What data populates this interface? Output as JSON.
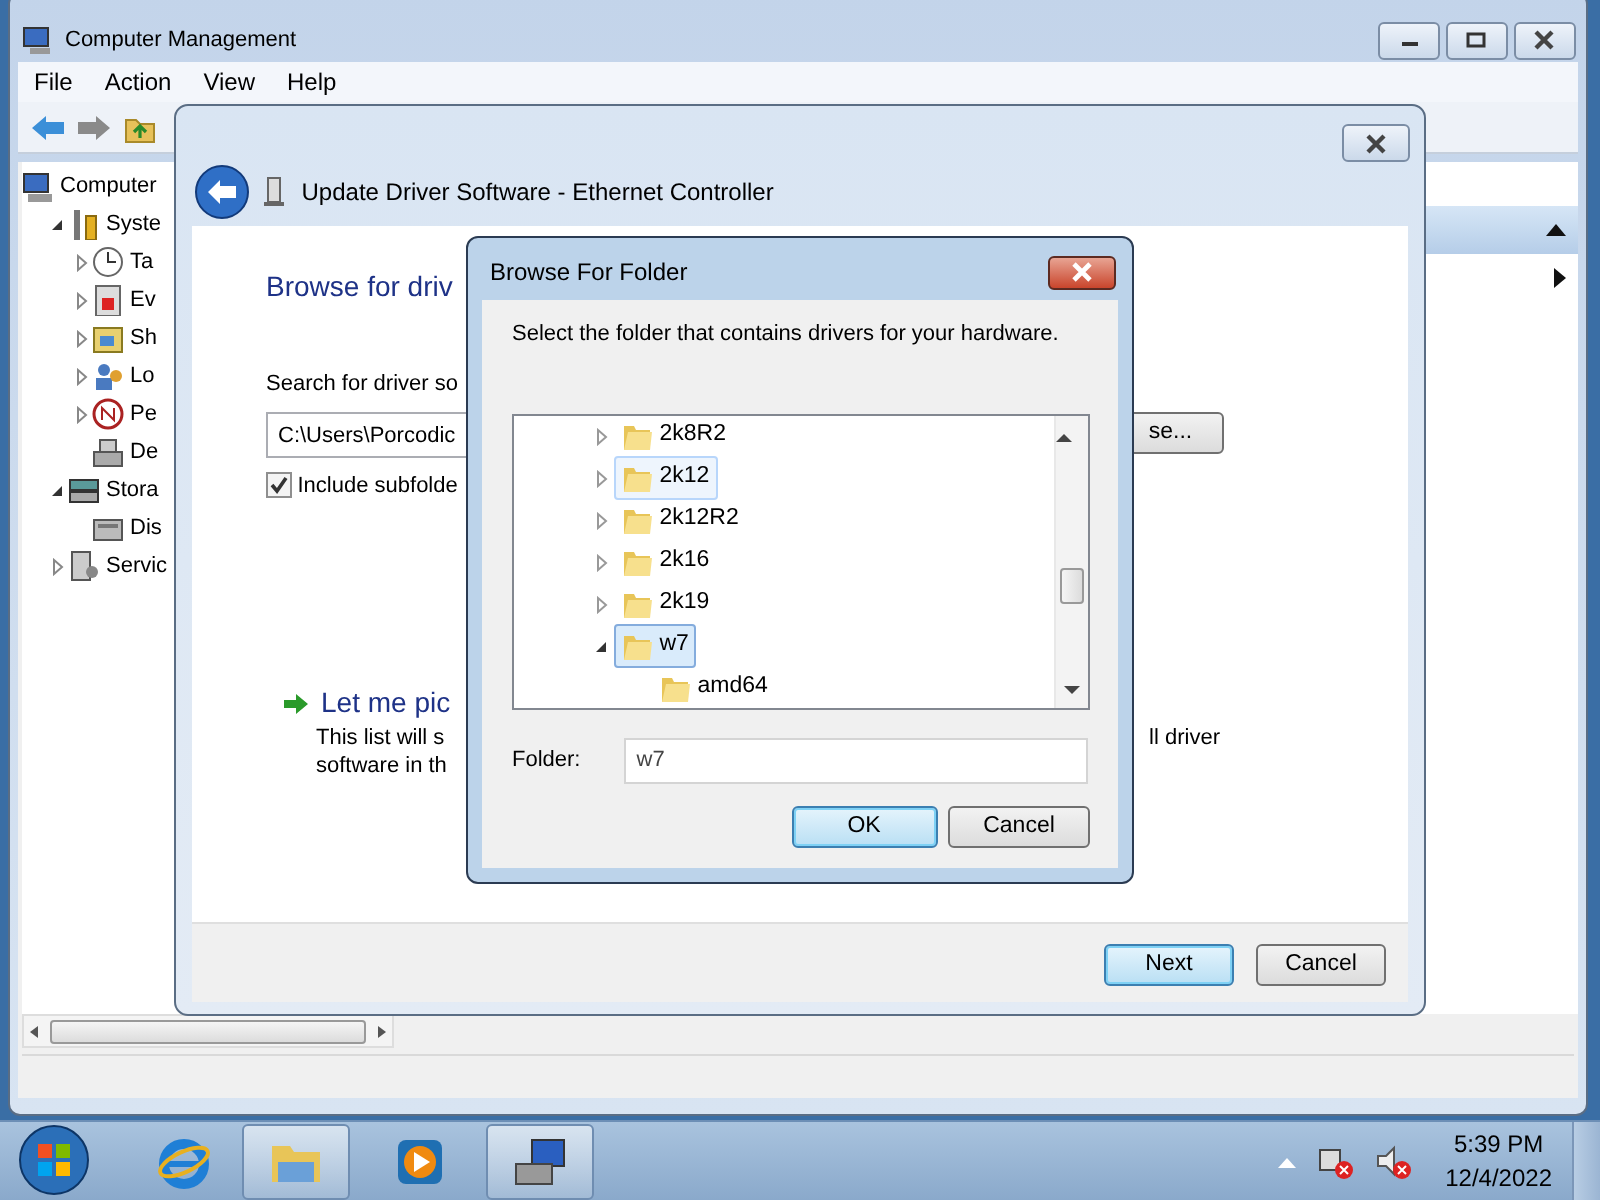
{
  "main_window": {
    "title": "Computer Management",
    "menu": [
      "File",
      "Action",
      "View",
      "Help"
    ],
    "tree": [
      {
        "label": "Computer",
        "children": [
          {
            "label": "Syste",
            "expanded": true,
            "children": [
              {
                "label": "Ta",
                "expanded": false
              },
              {
                "label": "Ev",
                "expanded": false
              },
              {
                "label": "Sh",
                "expanded": false
              },
              {
                "label": "Lo",
                "expanded": false
              },
              {
                "label": "Pe",
                "expanded": false
              },
              {
                "label": "De"
              }
            ]
          },
          {
            "label": "Stora",
            "expanded": true,
            "children": [
              {
                "label": "Dis"
              }
            ]
          },
          {
            "label": "Servic",
            "expanded": false
          }
        ]
      }
    ]
  },
  "wizard": {
    "title": "Update Driver Software - Ethernet Controller",
    "heading": "Browse for driv",
    "search_label": "Search for driver so",
    "path_value": "C:\\Users\\Porcodic",
    "browse_button": "se...",
    "include_subfolders": {
      "label": "Include subfolde",
      "checked": true
    },
    "pick_heading": "Let me pic",
    "pick_text_left": [
      "This list will s",
      "software in th"
    ],
    "pick_text_right": "ll driver",
    "buttons": [
      {
        "label": "Next",
        "default": true
      },
      {
        "label": "Cancel",
        "default": false
      }
    ]
  },
  "dialog": {
    "title": "Browse For Folder",
    "prompt": "Select the folder that contains drivers for your hardware.",
    "folders": [
      {
        "label": "2k8R2",
        "expanded": false,
        "selected": false,
        "hovered": false
      },
      {
        "label": "2k12",
        "expanded": false,
        "selected": false,
        "hovered": true
      },
      {
        "label": "2k12R2",
        "expanded": false,
        "selected": false,
        "hovered": false
      },
      {
        "label": "2k16",
        "expanded": false,
        "selected": false,
        "hovered": false
      },
      {
        "label": "2k19",
        "expanded": false,
        "selected": false,
        "hovered": false
      },
      {
        "label": "w7",
        "expanded": true,
        "selected": true,
        "hovered": false,
        "children": [
          {
            "label": "amd64",
            "selected": false,
            "hovered": false
          }
        ]
      }
    ],
    "folder_label": "Folder:",
    "folder_value": "w7",
    "buttons": [
      {
        "label": "OK",
        "default": true
      },
      {
        "label": "Cancel",
        "default": false
      }
    ]
  },
  "taskbar": {
    "apps": [
      {
        "kind": "ie",
        "running": false
      },
      {
        "kind": "explorer",
        "running": true
      },
      {
        "kind": "media",
        "running": false
      },
      {
        "kind": "compmgmt",
        "running": true
      }
    ],
    "time": "5:39 PM",
    "date": "12/4/2022"
  }
}
